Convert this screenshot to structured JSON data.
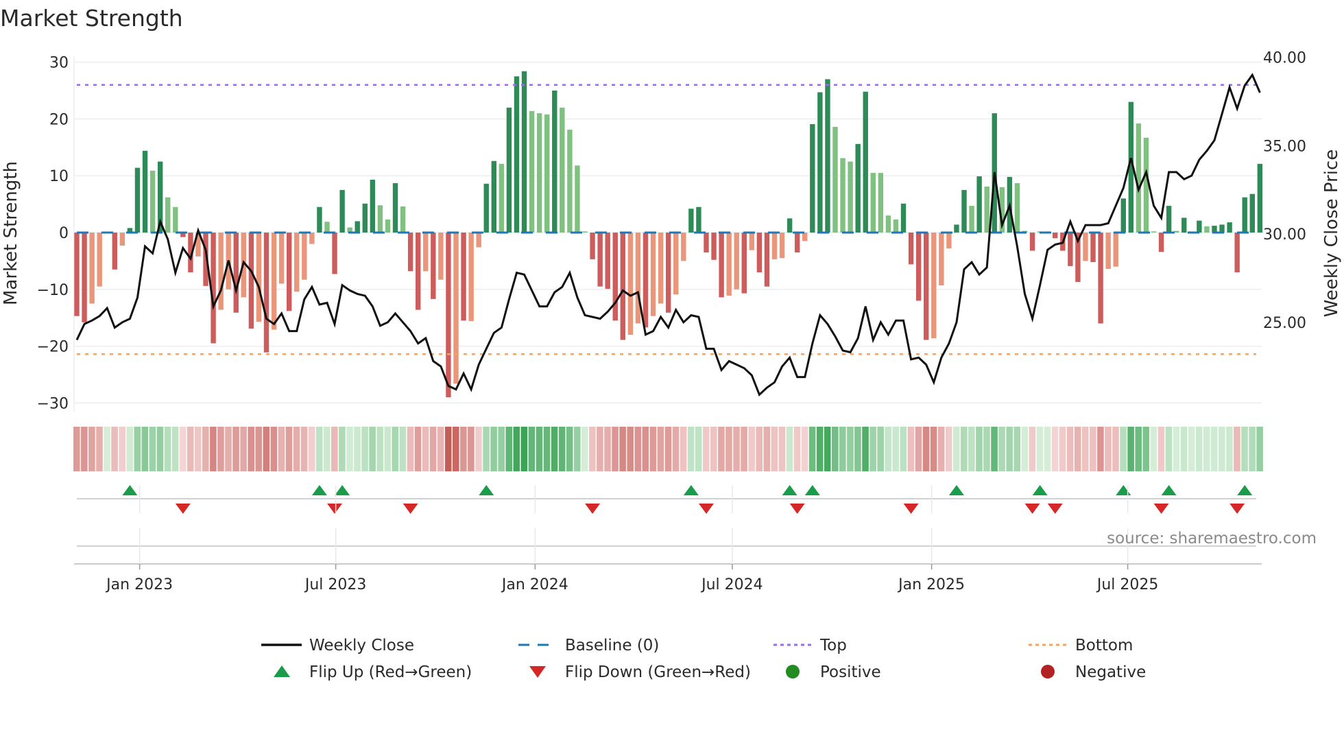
{
  "chart_data": {
    "type": "bar",
    "title": "Market Strength",
    "ylabel": "Market Strength",
    "y2label": "Weekly Close Price",
    "ylim": [
      -30,
      30
    ],
    "y2lim": [
      20.3,
      40
    ],
    "yticks": [
      "30",
      "20",
      "10",
      "0",
      "−10",
      "−20",
      "−30"
    ],
    "ytick_values": [
      30,
      20,
      10,
      0,
      -10,
      -20,
      -30
    ],
    "y2ticks": [
      "40.00",
      "35.00",
      "30.00",
      "25.00"
    ],
    "y2tick_values": [
      40,
      35,
      30,
      25
    ],
    "xticks": [
      {
        "label": "Jan 2023",
        "date": "2023-01-01"
      },
      {
        "label": "Jul 2023",
        "date": "2023-07-01"
      },
      {
        "label": "Jan 2024",
        "date": "2024-01-01"
      },
      {
        "label": "Jul 2024",
        "date": "2024-07-01"
      },
      {
        "label": "Jan 2025",
        "date": "2025-01-01"
      },
      {
        "label": "Jul 2025",
        "date": "2025-07-01"
      }
    ],
    "start_week": "2022-11-04",
    "top_level": 26,
    "bottom_level": -21.4,
    "baseline": 0,
    "strength": [
      -14.7,
      -15.8,
      -12.5,
      -9.5,
      0,
      -6.5,
      -2.3,
      0.8,
      11.4,
      14.4,
      10.9,
      12.5,
      6.2,
      4.5,
      -0.8,
      -7,
      -4.2,
      -9.4,
      -19.5,
      -13.6,
      -10,
      -14.1,
      -11.4,
      -16.9,
      -15.7,
      -21.1,
      -17.1,
      -9,
      -13.8,
      -10.4,
      -8.3,
      -2,
      4.5,
      1.9,
      -7.3,
      7.5,
      0.9,
      2,
      5.1,
      9.3,
      4.8,
      2.3,
      8.7,
      4.6,
      -6.8,
      -13.6,
      -6.8,
      -11.7,
      -8.3,
      -29,
      -26.6,
      -15.5,
      -15.6,
      -2.6,
      8.6,
      12.6,
      12.1,
      22,
      27.5,
      28.4,
      21.4,
      21,
      20.8,
      25,
      22,
      18.1,
      11.8,
      0.2,
      -4.7,
      -9.5,
      -9.9,
      -15.5,
      -18.9,
      -18,
      -16,
      -16.7,
      -14.7,
      -12.5,
      -14.1,
      -10.9,
      -5,
      4.2,
      4.5,
      -3.5,
      -4.8,
      -11.4,
      -11.1,
      -10,
      -10.7,
      -3.1,
      -7,
      -9.5,
      -4.7,
      -4.5,
      2.5,
      -3.5,
      -1.5,
      19.1,
      24.7,
      27,
      18.6,
      13.1,
      12.5,
      15.6,
      24.8,
      10.5,
      10.5,
      3,
      2.3,
      5.1,
      -5.6,
      -12,
      -18.9,
      -18.6,
      -9.3,
      -2.8,
      1.4,
      7.5,
      4.7,
      9.9,
      8.1,
      21,
      8,
      9.8,
      8.7,
      0.3,
      -3.2,
      0.2,
      0.2,
      -1,
      -3.2,
      -5.9,
      -8.7,
      -5,
      -5.2,
      -16,
      -6.4,
      -6,
      6,
      23,
      19.2,
      16.7,
      0.2,
      -3.4,
      4.7,
      0.3,
      2.6,
      0.2,
      2.1,
      1.1,
      1.2,
      1.4,
      1.8,
      -7,
      6.2,
      6.8,
      12.1
    ],
    "strong_shade": [
      1,
      1,
      0,
      0,
      0,
      1,
      0,
      1,
      1,
      1,
      0,
      1,
      0,
      0,
      1,
      1,
      0,
      1,
      1,
      0,
      0,
      1,
      0,
      1,
      0,
      1,
      0,
      0,
      1,
      0,
      0,
      0,
      1,
      0,
      1,
      1,
      0,
      1,
      1,
      1,
      0,
      0,
      1,
      0,
      1,
      1,
      0,
      1,
      0,
      1,
      0,
      1,
      0,
      0,
      1,
      1,
      0,
      1,
      1,
      1,
      0,
      0,
      0,
      1,
      0,
      0,
      0,
      0,
      1,
      1,
      1,
      1,
      1,
      0,
      0,
      1,
      0,
      0,
      1,
      0,
      0,
      1,
      1,
      1,
      1,
      1,
      0,
      0,
      1,
      0,
      1,
      1,
      0,
      0,
      1,
      1,
      0,
      1,
      1,
      1,
      0,
      0,
      0,
      1,
      1,
      0,
      0,
      0,
      0,
      1,
      1,
      1,
      1,
      0,
      0,
      0,
      1,
      1,
      0,
      1,
      0,
      1,
      0,
      1,
      0,
      0,
      1,
      0,
      0,
      1,
      1,
      1,
      1,
      0,
      1,
      1,
      0,
      0,
      1,
      1,
      0,
      0,
      0,
      1,
      1,
      0,
      1,
      0,
      1,
      0,
      1,
      1,
      1,
      1,
      1,
      1,
      1
    ],
    "weekly_close": [
      24.0,
      24.9,
      25.1,
      25.35,
      25.8,
      24.7,
      25.0,
      25.2,
      26.4,
      29.3,
      28.9,
      30.7,
      29.7,
      27.8,
      29.2,
      28.6,
      30.2,
      29.1,
      25.9,
      26.8,
      28.5,
      26.8,
      28.4,
      27.9,
      27.0,
      25.2,
      24.9,
      25.5,
      24.5,
      24.5,
      26.3,
      27.0,
      26.0,
      26.1,
      24.9,
      27.1,
      26.8,
      26.6,
      26.5,
      25.9,
      24.8,
      25.0,
      25.5,
      25.0,
      24.5,
      23.8,
      24.1,
      22.8,
      22.5,
      21.4,
      21.2,
      22.1,
      21.2,
      22.6,
      23.5,
      24.4,
      24.7,
      26.3,
      27.8,
      27.7,
      26.8,
      25.9,
      25.9,
      26.7,
      27.0,
      27.8,
      26.4,
      25.4,
      25.3,
      25.2,
      25.6,
      26.1,
      26.8,
      26.5,
      26.7,
      24.3,
      24.5,
      25.3,
      24.7,
      25.7,
      25.0,
      25.4,
      25.3,
      23.5,
      23.5,
      22.3,
      22.8,
      22.6,
      22.4,
      22.0,
      20.9,
      21.3,
      21.6,
      22.5,
      23.0,
      21.9,
      21.9,
      23.8,
      25.4,
      24.9,
      24.2,
      23.4,
      23.3,
      24.1,
      25.9,
      24.0,
      25.0,
      24.3,
      25.1,
      25.1,
      22.9,
      23.0,
      22.6,
      21.6,
      23.0,
      23.8,
      25.0,
      28.0,
      28.4,
      27.7,
      28.1,
      33.5,
      30.5,
      31.6,
      29.3,
      26.6,
      25.2,
      27.1,
      29.1,
      29.4,
      29.5,
      30.7,
      29.6,
      30.5,
      30.5,
      30.5,
      30.6,
      31.6,
      32.6,
      34.3,
      32.5,
      33.5,
      31.6,
      30.9,
      33.5,
      33.5,
      33.1,
      33.3,
      34.2,
      34.7,
      35.3,
      36.8,
      38.3,
      37.1,
      38.4,
      39.0,
      38.0
    ],
    "flip_up_weeks": [
      7,
      32,
      35,
      54,
      81,
      94,
      97,
      116,
      127,
      138,
      144,
      154
    ],
    "flip_down_weeks": [
      14,
      34,
      44,
      68,
      83,
      95,
      110,
      126,
      129,
      143,
      153
    ],
    "legend": {
      "placement": "bottom",
      "items": [
        {
          "label": "Weekly Close",
          "kind": "line",
          "color": "#111111"
        },
        {
          "label": "Baseline (0)",
          "kind": "dash",
          "color": "#1f77b4"
        },
        {
          "label": "Top",
          "kind": "dot",
          "color": "#9b6ee0"
        },
        {
          "label": "Bottom",
          "kind": "dot",
          "color": "#f4a460"
        },
        {
          "label": "Flip Up (Red→Green)",
          "kind": "tri-up",
          "color": "#1a9c4a"
        },
        {
          "label": "Flip Down (Green→Red)",
          "kind": "tri-down",
          "color": "#d62728"
        },
        {
          "label": "Positive",
          "kind": "circle",
          "color": "#228b22"
        },
        {
          "label": "Negative",
          "kind": "circle",
          "color": "#b22222"
        }
      ]
    },
    "colors": {
      "green_strong": "#2e8b57",
      "green_weak": "#80c080",
      "red_strong": "#cd5c5c",
      "red_weak": "#e9967a",
      "top": "#9b6ee0",
      "bottom": "#f4a460",
      "baseline": "#1f77b4",
      "close": "#111111"
    }
  },
  "source": "source: sharemaestro.com"
}
